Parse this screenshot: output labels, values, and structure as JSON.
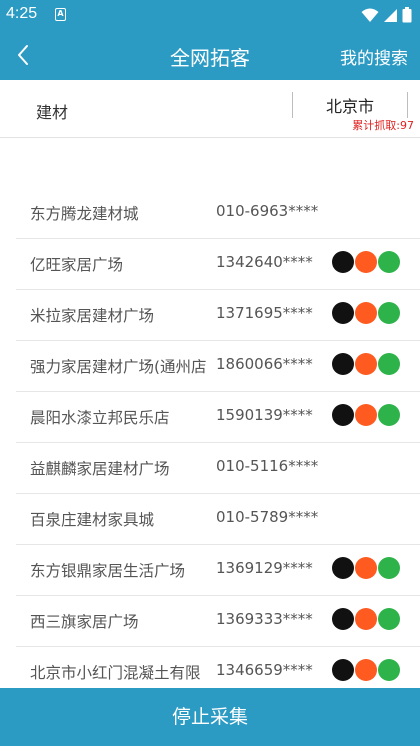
{
  "status": {
    "time": "4:25",
    "app_badge": "A"
  },
  "header": {
    "title": "全网拓客",
    "action": "我的搜索"
  },
  "search": {
    "keyword": "建材",
    "city": "北京市",
    "count_label": "累计抓取:97"
  },
  "rows": [
    {
      "name": "东方腾龙建材城",
      "phone": "010-6963****",
      "icons": false
    },
    {
      "name": "亿旺家居广场",
      "phone": "1342640****",
      "icons": true
    },
    {
      "name": "米拉家居建材广场",
      "phone": "1371695****",
      "icons": true
    },
    {
      "name": "强力家居建材广场(通州店",
      "phone": "1860066****",
      "icons": true
    },
    {
      "name": "晨阳水漆立邦民乐店",
      "phone": "1590139****",
      "icons": true
    },
    {
      "name": "益麒麟家居建材广场",
      "phone": "010-5116****",
      "icons": false
    },
    {
      "name": "百泉庄建材家具城",
      "phone": "010-5789****",
      "icons": false
    },
    {
      "name": "东方银鼎家居生活广场",
      "phone": "1369129****",
      "icons": true
    },
    {
      "name": "西三旗家居广场",
      "phone": "1369333****",
      "icons": true
    },
    {
      "name": "北京市小红门混凝土有限",
      "phone": "1346659****",
      "icons": true
    }
  ],
  "icons": {
    "tiktok": "tiktok-icon",
    "kuaishou": "kuaishou-icon",
    "wechat": "wechat-icon"
  },
  "colors": {
    "primary": "#2b9bc4",
    "count_red": "#e02020"
  },
  "footer": {
    "label": "停止采集"
  }
}
